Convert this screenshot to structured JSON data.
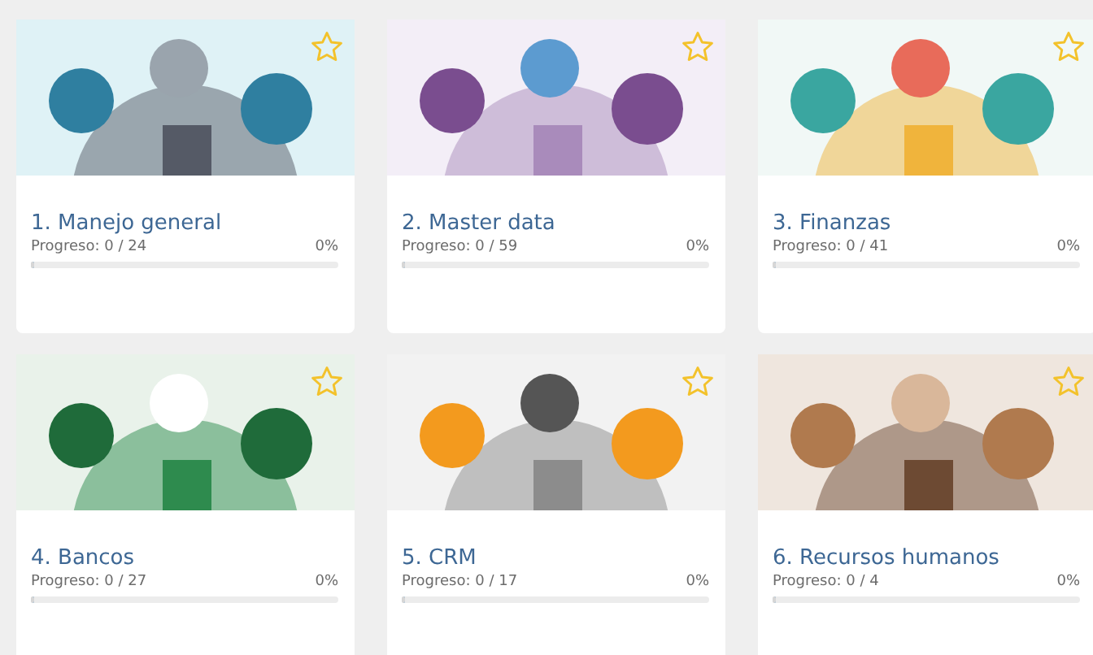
{
  "courses": [
    {
      "title": "1. Manejo general",
      "progress": "Progreso: 0 / 24",
      "percent": "0%",
      "level": 0,
      "favorite": false
    },
    {
      "title": "2. Master data",
      "progress": "Progreso: 0 / 59",
      "percent": "0%",
      "level": 0,
      "favorite": false
    },
    {
      "title": "3. Finanzas",
      "progress": "Progreso: 0 / 41",
      "percent": "0%",
      "level": 0,
      "favorite": false
    },
    {
      "title": "4. Bancos",
      "progress": "Progreso: 0 / 27",
      "percent": "0%",
      "level": 0,
      "favorite": false
    },
    {
      "title": "5. CRM",
      "progress": "Progreso: 0 / 17",
      "percent": "0%",
      "level": 0,
      "favorite": false
    },
    {
      "title": "6. Recursos humanos",
      "progress": "Progreso: 0 / 4",
      "percent": "0%",
      "level": 0,
      "favorite": false
    }
  ]
}
